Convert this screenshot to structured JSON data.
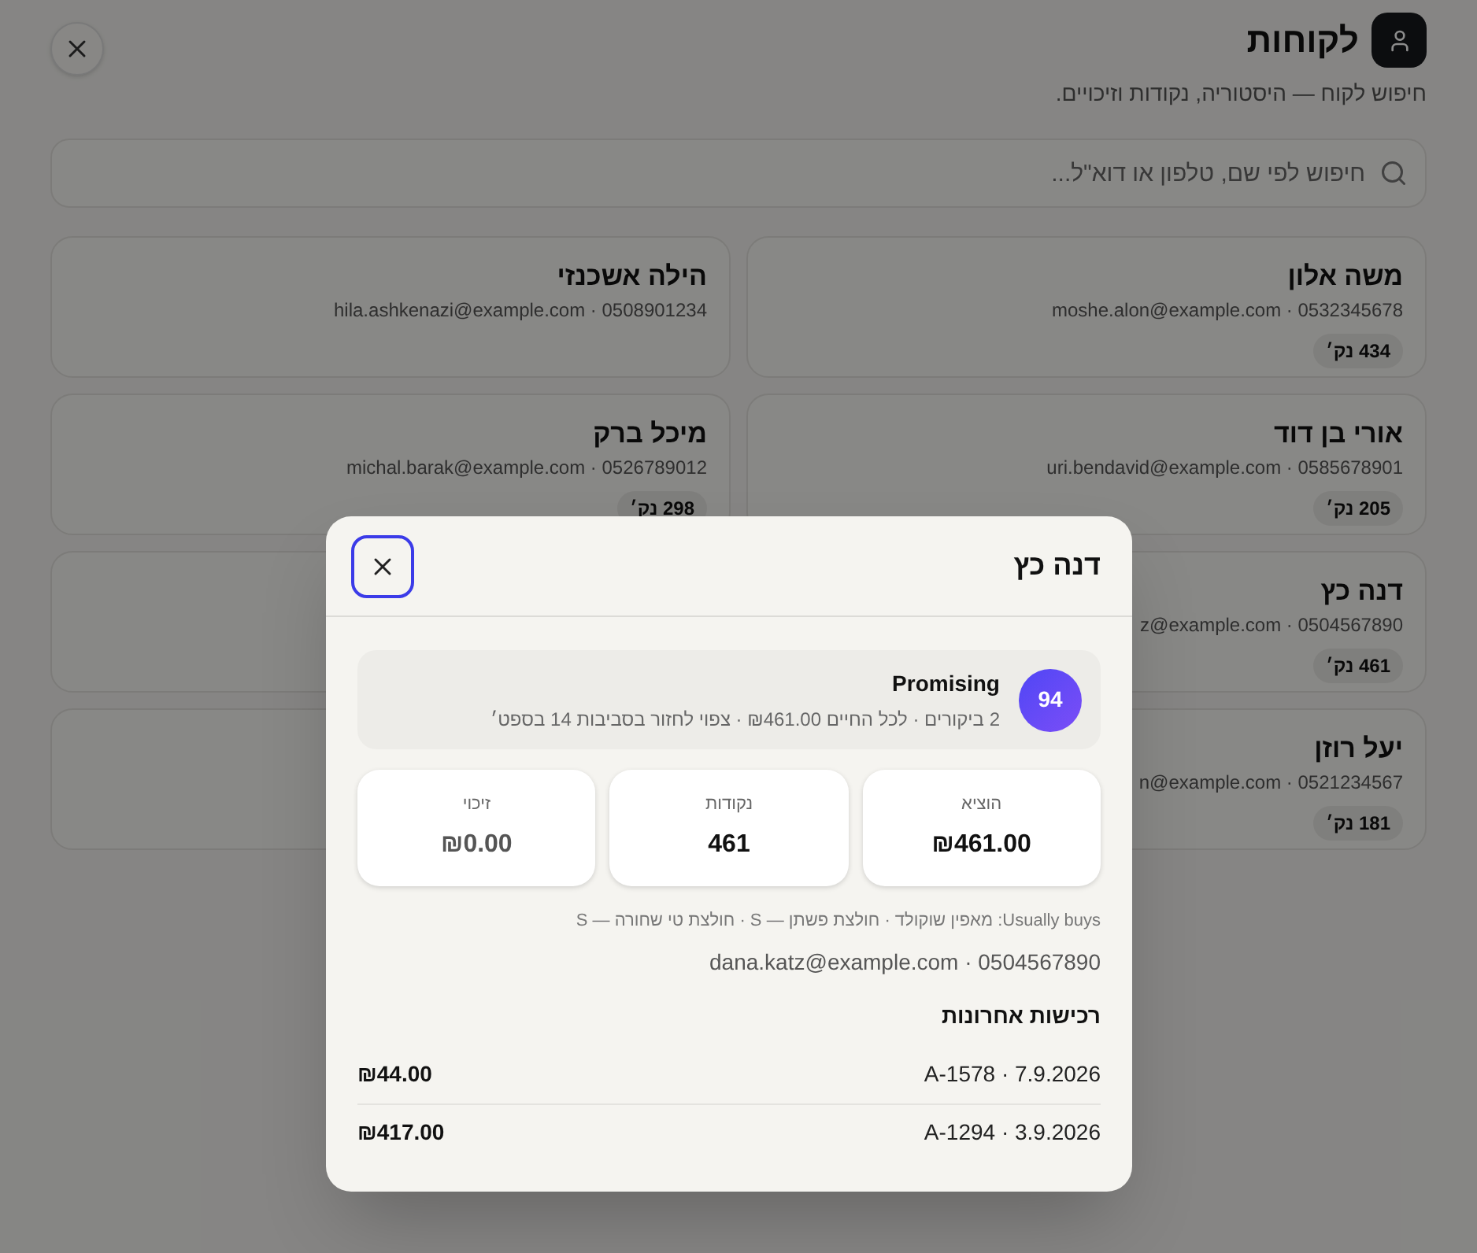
{
  "header": {
    "title": "לקוחות",
    "subtitle": "חיפוש לקוח — היסטוריה, נקודות וזיכויים."
  },
  "search": {
    "placeholder": "חיפוש לפי שם, טלפון או דוא\"ל..."
  },
  "customers": [
    {
      "kind": "customer",
      "name": "משה אלון",
      "contact": "moshe.alon@example.com · 0532345678",
      "points": "434 נק׳"
    },
    {
      "kind": "customer",
      "name": "הילה אשכנזי",
      "contact": "hila.ashkenazi@example.com · 0508901234"
    },
    {
      "kind": "customer",
      "name": "אורי בן דוד",
      "contact": "uri.bendavid@example.com · 0585678901",
      "points": "205 נק׳"
    },
    {
      "kind": "customer",
      "name": "מיכל ברק",
      "contact": "michal.barak@example.com · 0526789012",
      "points": "298 נק׳"
    },
    {
      "kind": "customer",
      "name": "דנה כץ",
      "contact": "z@example.com · 0504567890",
      "points": "461 נק׳"
    },
    {
      "kind": "hidden"
    },
    {
      "kind": "customer",
      "name": "יעל רוזן",
      "contact": "n@example.com · 0521234567",
      "points": "181 נק׳"
    },
    {
      "kind": "hidden"
    }
  ],
  "dialog": {
    "title": "דנה כץ",
    "segment": {
      "score": "94",
      "label": "Promising",
      "details": "2 ביקורים · לכל החיים ₪461.00 · צפוי לחזור בסביבות 14 בספט׳"
    },
    "stats": [
      {
        "label": "הוציא",
        "value": "₪461.00",
        "muted": false
      },
      {
        "label": "נקודות",
        "value": "461",
        "muted": false
      },
      {
        "label": "זיכוי",
        "value": "₪0.00",
        "muted": true
      }
    ],
    "usually_buys": "Usually buys: מאפין שוקולד · חולצת פשתן — S · חולצת טי שחורה — S",
    "contact": "dana.katz@example.com · 0504567890",
    "purchases_title": "רכישות אחרונות",
    "purchases": [
      {
        "order": "A-1578 · 7.9.2026",
        "amount": "₪44.00"
      },
      {
        "order": "A-1294 · 3.9.2026",
        "amount": "₪417.00"
      }
    ]
  }
}
